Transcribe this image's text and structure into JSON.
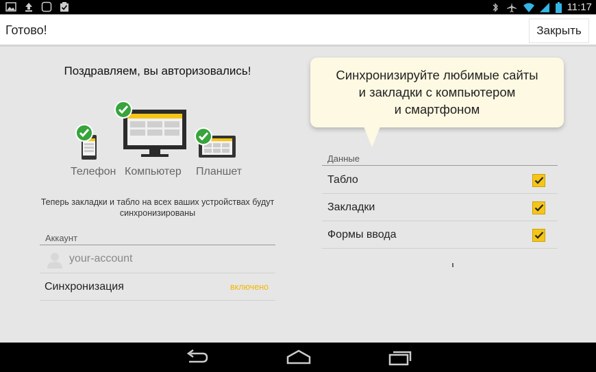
{
  "statusbar": {
    "time": "11:17",
    "left_icons": [
      "image-icon",
      "upload-icon",
      "window-icon",
      "clipboard-check-icon"
    ],
    "right_icons": [
      "bluetooth-icon",
      "airplane-icon",
      "wifi-icon",
      "signal-icon",
      "battery-icon"
    ]
  },
  "actionbar": {
    "title": "Готово!",
    "close_label": "Закрыть"
  },
  "left": {
    "congrats": "Поздравляем, вы авторизовались!",
    "devices": {
      "phone": "Телефон",
      "computer": "Компьютер",
      "tablet": "Планшет"
    },
    "description": "Теперь закладки и табло на всех ваших устройствах будут синхронизированы",
    "account_header": "Аккаунт",
    "account_name": "your-account",
    "sync_label": "Синхронизация",
    "sync_value": "включено"
  },
  "bubble": {
    "line1": "Синхронизируйте любимые сайты",
    "line2": "и закладки с компьютером",
    "line3": "и смартфоном"
  },
  "right": {
    "data_header": "Данные",
    "items": [
      {
        "label": "Табло",
        "checked": true
      },
      {
        "label": "Закладки",
        "checked": true
      },
      {
        "label": "Формы ввода",
        "checked": true
      }
    ]
  },
  "navbar": {
    "icons": [
      "back-icon",
      "home-icon",
      "recent-apps-icon"
    ]
  },
  "colors": {
    "accent": "#f5c518",
    "check_green": "#37a43c",
    "enabled_text": "#f2b705"
  }
}
